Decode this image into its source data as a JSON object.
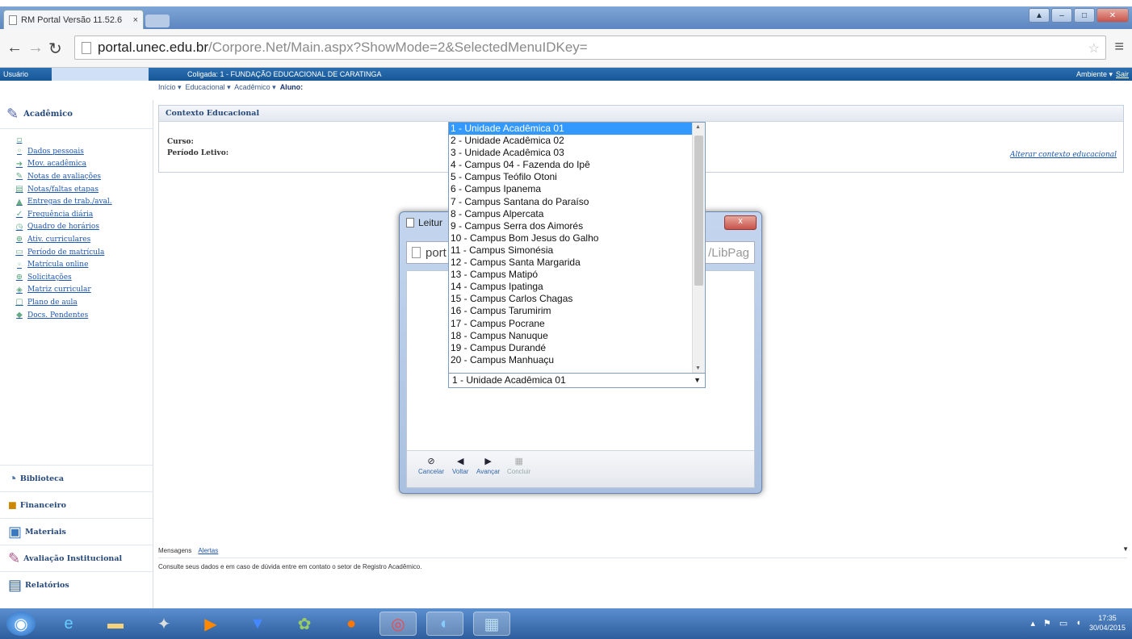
{
  "browser": {
    "tab_title": "RM Portal Versão 11.52.6",
    "tab_close": "×",
    "url_host": "portal.unec.edu.br",
    "url_path": "/Corpore.Net/Main.aspx?ShowMode=2&SelectedMenuIDKey="
  },
  "header": {
    "user_label": "Usuário",
    "coligada": "Coligada: 1 - FUNDAÇÃO EDUCACIONAL DE CARATINGA",
    "ambiente": "Ambiente ▾",
    "sair": "Sair"
  },
  "breadcrumb": {
    "inicio": "Início ▾",
    "educacional": "Educacional ▾",
    "academico": "Acadêmico ▾",
    "aluno": "Aluno:"
  },
  "sidebar": {
    "title": "Acadêmico",
    "items": [
      {
        "label": "Dados pessoais",
        "icon": "user-icon"
      },
      {
        "label": "Mov. acadêmica",
        "icon": "move-icon"
      },
      {
        "label": "Notas de avaliações",
        "icon": "grades-icon"
      },
      {
        "label": "Notas/faltas etapas",
        "icon": "table-icon"
      },
      {
        "label": "Entregas de trab./aval.",
        "icon": "delivery-icon"
      },
      {
        "label": "Frequência diária",
        "icon": "attendance-icon"
      },
      {
        "label": "Quadro de horários",
        "icon": "clock-icon"
      },
      {
        "label": "Ativ. curriculares",
        "icon": "activity-icon"
      },
      {
        "label": "Período de matrícula",
        "icon": "calendar-icon"
      },
      {
        "label": "Matrícula online",
        "icon": "enroll-icon"
      },
      {
        "label": "Solicitações",
        "icon": "request-icon"
      },
      {
        "label": "Matriz curricular",
        "icon": "matrix-icon"
      },
      {
        "label": "Plano de aula",
        "icon": "plan-icon"
      },
      {
        "label": "Docs. Pendentes",
        "icon": "documents-icon"
      }
    ],
    "sections": [
      "Biblioteca",
      "Financeiro",
      "Materiais",
      "Avaliação Institucional",
      "Relatórios"
    ]
  },
  "context": {
    "title": "Contexto Educacional",
    "curso_label": "Curso:",
    "periodo_label": "Período Letivo:",
    "alterar_link": "Alterar contexto educacional"
  },
  "dialog": {
    "title": "Leitur",
    "url_start": "port",
    "url_tail": "/LibPag",
    "close": "x",
    "buttons": {
      "cancelar": "Cancelar",
      "voltar": "Voltar",
      "avancar": "Avançar",
      "concluir": "Concluir"
    }
  },
  "dropdown": {
    "selected": "1 - Unidade Acadêmica 01",
    "options": [
      "1 - Unidade Acadêmica 01",
      "2 - Unidade Acadêmica 02",
      "3 - Unidade Acadêmica 03",
      "4 - Campus 04 - Fazenda do Ipê",
      "5 - Campus Teófilo Otoni",
      "6 - Campus Ipanema",
      "7 - Campus Santana do Paraíso",
      "8 - Campus Alpercata",
      "9 - Campus Serra dos Aimorés",
      "10 - Campus Bom Jesus do Galho",
      "11 - Campus Simonésia",
      "12 - Campus Santa Margarida",
      "13 - Campus Matipó",
      "14 - Campus Ipatinga",
      "15 - Campus Carlos Chagas",
      "16 - Campus Tarumirim",
      "17 - Campus Pocrane",
      "18 - Campus Nanuque",
      "19 - Campus Durandé",
      "20 - Campus Manhuaçu"
    ]
  },
  "messages": {
    "tab_mensagens": "Mensagens",
    "tab_alertas": "Alertas",
    "text": "Consulte seus dados e em caso de dúvida entre em contato o setor de Registro Acadêmico."
  },
  "taskbar": {
    "time": "17:35",
    "date": "30/04/2015"
  }
}
